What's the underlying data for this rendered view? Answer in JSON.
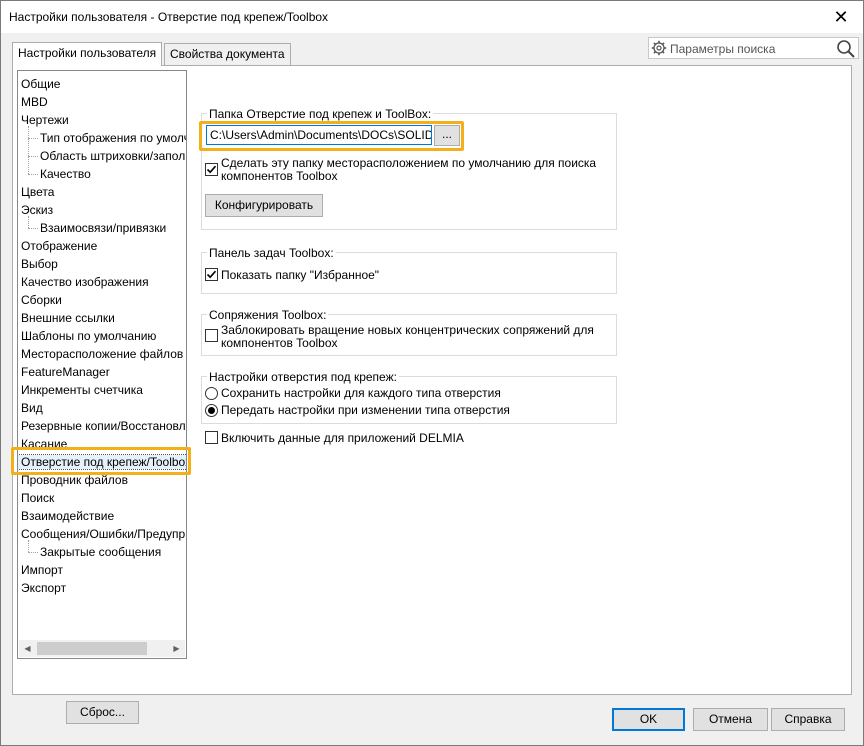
{
  "window": {
    "title": "Настройки пользователя - Отверстие под крепеж/Toolbox",
    "close_symbol": "✕"
  },
  "tabs": [
    {
      "label": "Настройки пользователя",
      "active": true
    },
    {
      "label": "Свойства документа",
      "active": false
    }
  ],
  "search": {
    "placeholder": "Параметры поиска"
  },
  "tree": {
    "items": [
      {
        "label": "Общие",
        "level": 0
      },
      {
        "label": "MBD",
        "level": 0
      },
      {
        "label": "Чертежи",
        "level": 0
      },
      {
        "label": "Тип отображения по умолч",
        "level": 1
      },
      {
        "label": "Область штриховки/запол",
        "level": 1
      },
      {
        "label": "Качество",
        "level": 1
      },
      {
        "label": "Цвета",
        "level": 0
      },
      {
        "label": "Эскиз",
        "level": 0
      },
      {
        "label": "Взаимосвязи/привязки",
        "level": 1
      },
      {
        "label": "Отображение",
        "level": 0
      },
      {
        "label": "Выбор",
        "level": 0
      },
      {
        "label": "Качество изображения",
        "level": 0
      },
      {
        "label": "Сборки",
        "level": 0
      },
      {
        "label": "Внешние ссылки",
        "level": 0
      },
      {
        "label": "Шаблоны по умолчанию",
        "level": 0
      },
      {
        "label": "Месторасположение файлов",
        "level": 0
      },
      {
        "label": "FeatureManager",
        "level": 0
      },
      {
        "label": "Инкременты счетчика",
        "level": 0
      },
      {
        "label": "Вид",
        "level": 0
      },
      {
        "label": "Резервные копии/Восстановл",
        "level": 0
      },
      {
        "label": "Касание",
        "level": 0
      },
      {
        "label": "Отверстие под крепеж/Toolbox",
        "level": 0,
        "selected": true
      },
      {
        "label": "Проводник файлов",
        "level": 0
      },
      {
        "label": "Поиск",
        "level": 0
      },
      {
        "label": "Взаимодействие",
        "level": 0
      },
      {
        "label": "Сообщения/Ошибки/Предупр",
        "level": 0
      },
      {
        "label": "Закрытые сообщения",
        "level": 1
      },
      {
        "label": "Импорт",
        "level": 0
      },
      {
        "label": "Экспорт",
        "level": 0
      }
    ],
    "reset_button": "Сброс..."
  },
  "toolbox_folder": {
    "caption": "Папка Отверстие под крепеж и ToolBox:",
    "path": "C:\\Users\\Admin\\Documents\\DOCs\\SOLIDW",
    "browse_label": "...",
    "default_location_checkbox": {
      "line1": "Сделать эту папку месторасположением по умолчанию для поиска",
      "line2": "компонентов Toolbox",
      "checked": true
    },
    "configure_button": "Конфигурировать"
  },
  "task_pane": {
    "caption": "Панель задач Toolbox:",
    "show_favorites": {
      "label": "Показать папку \"Избранное\"",
      "checked": true
    }
  },
  "mates": {
    "caption": "Сопряжения Toolbox:",
    "lock_rotation": {
      "line1": "Заблокировать вращение новых концентрических сопряжений для",
      "line2": "компонентов Toolbox",
      "checked": false
    }
  },
  "hole_settings": {
    "caption": "Настройки отверстия под крепеж:",
    "options": [
      {
        "label": "Сохранить настройки для каждого типа отверстия",
        "selected": false
      },
      {
        "label": "Передать настройки при изменении типа отверстия",
        "selected": true
      }
    ]
  },
  "delmia": {
    "label": "Включить данные для приложений DELMIA",
    "checked": false
  },
  "footer": {
    "ok": "OK",
    "cancel": "Отмена",
    "help": "Справка"
  },
  "colors": {
    "highlight": "#f4b019",
    "focus": "#0078d7"
  }
}
